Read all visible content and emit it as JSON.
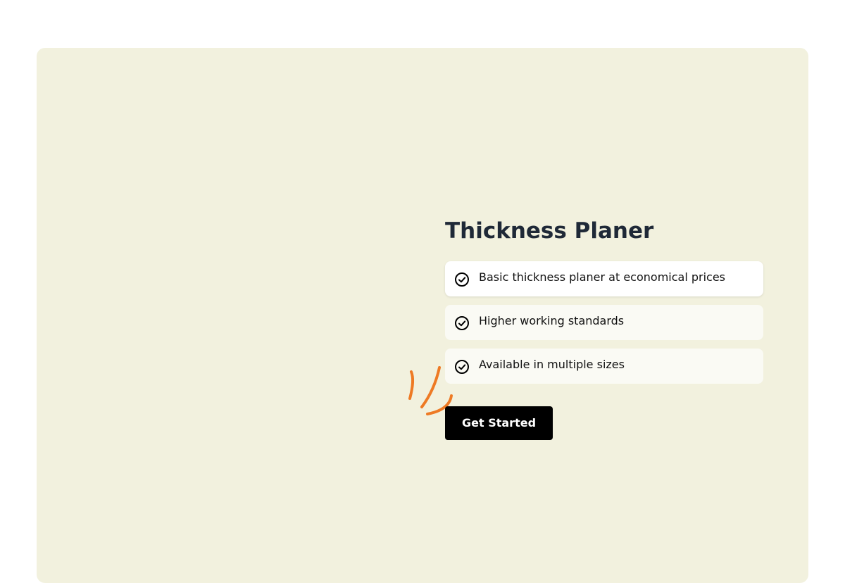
{
  "hero": {
    "title": "Thickness Planer",
    "features": [
      {
        "label": "Basic thickness planer at economical prices",
        "icon": "check-circle-icon"
      },
      {
        "label": "Higher working standards",
        "icon": "check-circle-icon"
      },
      {
        "label": "Available in multiple sizes",
        "icon": "check-circle-icon"
      }
    ],
    "cta_label": "Get Started",
    "decor_icon": "sparkle-strokes-icon"
  },
  "colors": {
    "panel_background": "#f2f1de",
    "accent": "#ee7a24",
    "title": "#1f2937",
    "button": "#000000",
    "button_text": "#ffffff"
  }
}
